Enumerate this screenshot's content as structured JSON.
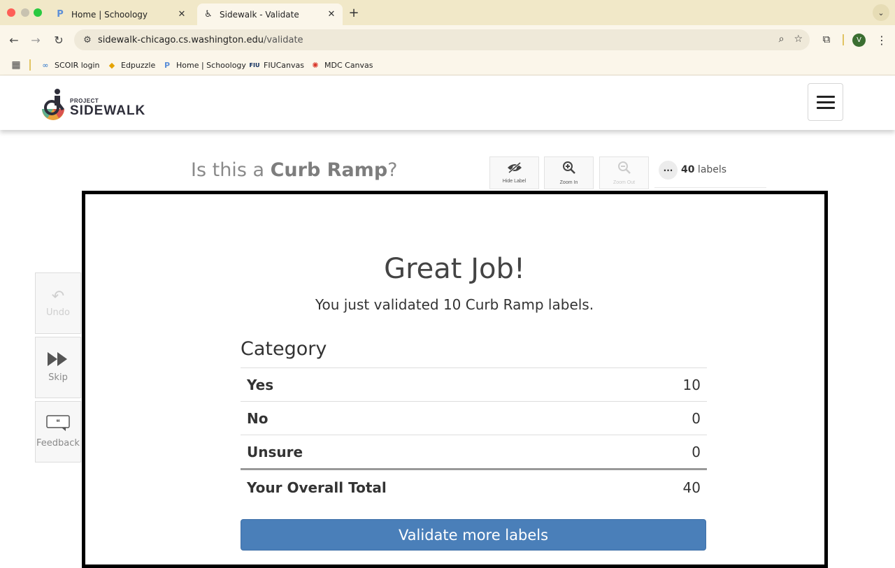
{
  "browser": {
    "tabs": [
      {
        "title": "Home | Schoology",
        "favicon": "schoology-icon"
      },
      {
        "title": "Sidewalk - Validate",
        "favicon": "sidewalk-icon"
      }
    ],
    "url_host": "sidewalk-chicago.cs.washington.edu",
    "url_path": "/validate",
    "profile_initial": "V",
    "bookmarks": [
      {
        "label": "SCOIR login",
        "icon": "scoir-icon"
      },
      {
        "label": "Edpuzzle",
        "icon": "edpuzzle-icon"
      },
      {
        "label": "Home | Schoology",
        "icon": "schoology-icon"
      },
      {
        "label": "FIUCanvas",
        "icon": "fiu-icon"
      },
      {
        "label": "MDC Canvas",
        "icon": "canvas-icon"
      }
    ]
  },
  "site": {
    "logo_small": "PROJECT",
    "logo_big": "SIDEWALK"
  },
  "validate": {
    "question_prefix": "Is this a ",
    "label_type": "Curb Ramp",
    "question_suffix": "?",
    "controls": {
      "hide_label": "Hide Label",
      "zoom_in": "Zoom In",
      "zoom_out": "Zoom Out"
    },
    "more": "···",
    "label_count": "40",
    "label_count_suffix": " labels",
    "side": {
      "undo": "Undo",
      "skip": "Skip",
      "feedback": "Feedback"
    }
  },
  "result": {
    "heading": "Great Job!",
    "subtitle": "You just validated 10 Curb Ramp labels.",
    "category_title": "Category",
    "rows": [
      {
        "label": "Yes",
        "value": "10"
      },
      {
        "label": "No",
        "value": "0"
      },
      {
        "label": "Unsure",
        "value": "0"
      }
    ],
    "total_label": "Your Overall Total",
    "total_value": "40",
    "button": "Validate more labels"
  },
  "colors": {
    "tabbar": "#f1e8c8",
    "button_blue": "#4a7fb9",
    "panel_border": "#000000"
  }
}
